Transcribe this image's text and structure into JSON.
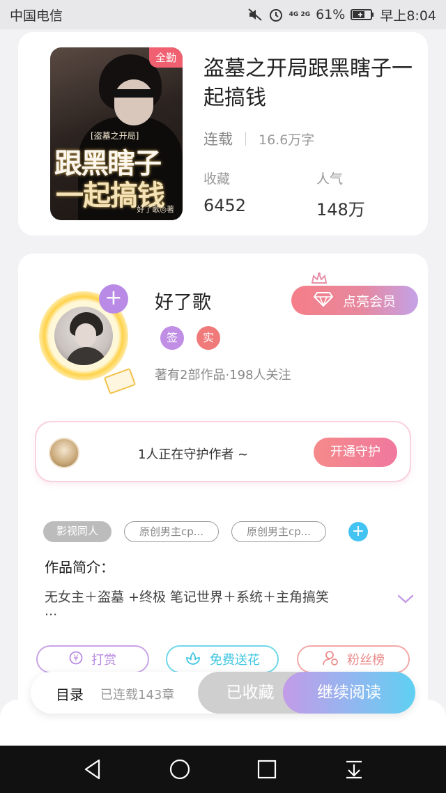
{
  "status_bar": {
    "carrier": "中国电信",
    "network": "4G 2G",
    "battery": "61%",
    "time": "早上8:04"
  },
  "book": {
    "cover_badge": "全勤",
    "cover_subtitle": "[盗墓之开局]",
    "cover_title_line1": "跟黑瞎子",
    "cover_title_line2": "一起搞钱",
    "cover_author_mark": "好了歌◎著",
    "title": "盗墓之开局跟黑瞎子一起搞钱",
    "status": "连载",
    "words": "16.6万字",
    "favorites_label": "收藏",
    "favorites_value": "6452",
    "popularity_label": "人气",
    "popularity_value": "148万"
  },
  "author": {
    "name": "好了歌",
    "tag_sign": "签",
    "tag_real": "实",
    "stats": "著有2部作品·198人关注",
    "vip_button": "点亮会员",
    "guard_text": "1人正在守护作者 ~",
    "guard_button": "开通守护"
  },
  "tags": [
    "影视同人",
    "原创男主cp...",
    "原创男主cp..."
  ],
  "intro": {
    "label": "作品简介：",
    "text": "无女主＋盗墓 +终极 笔记世界＋系统＋主角搞笑",
    "ellipsis": "..."
  },
  "actions": {
    "reward": "打赏",
    "flower": "免费送花",
    "fans": "粉丝榜"
  },
  "bottom_bar": {
    "toc": "目录",
    "serial": "已连载143章",
    "collected": "已收藏",
    "continue": "继续阅读"
  },
  "colors": {
    "accent_purple": "#b98be6",
    "accent_blue": "#5fd0f2",
    "accent_pink": "#f07a7a"
  }
}
